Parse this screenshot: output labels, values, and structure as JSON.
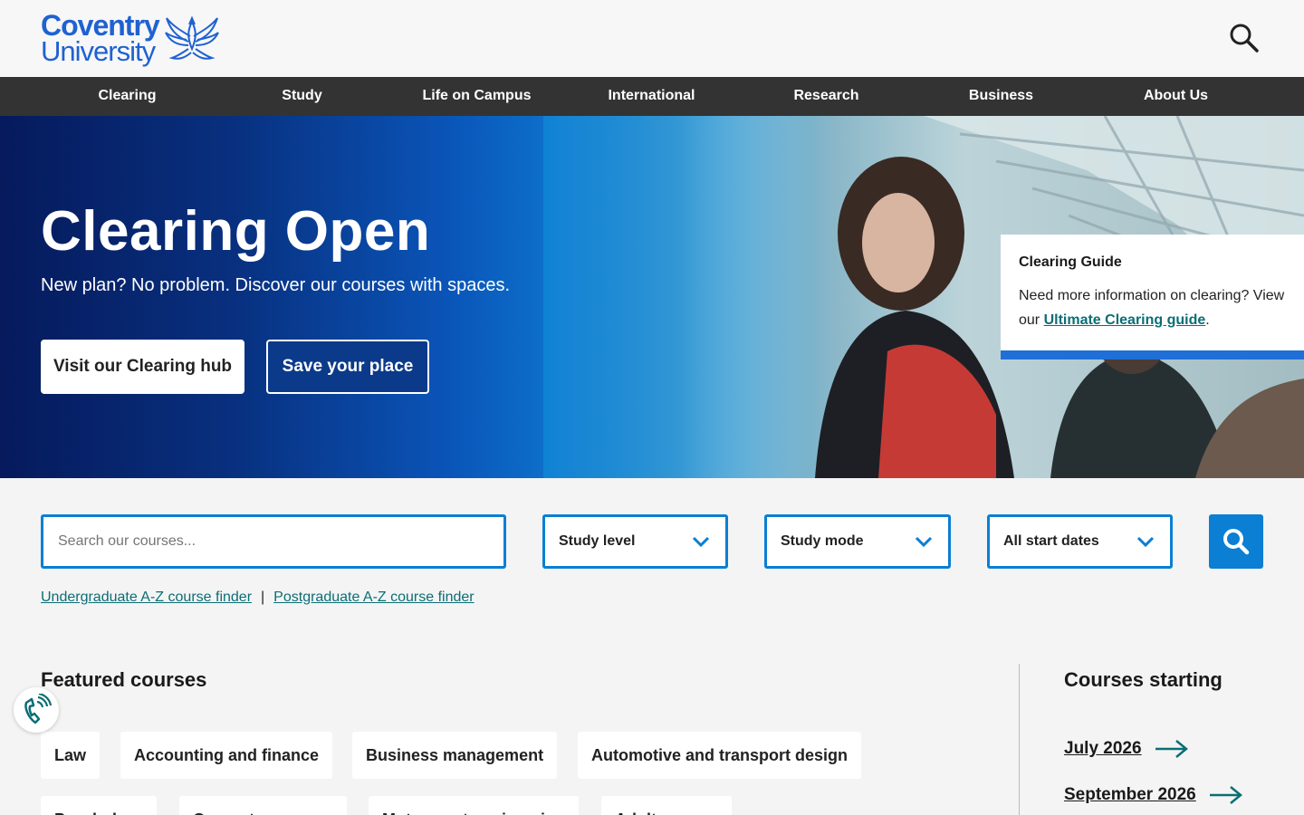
{
  "header": {
    "logo_line1": "Coventry",
    "logo_line2": "University",
    "brand_color": "#1f62d1"
  },
  "nav": {
    "items": [
      "Clearing",
      "Study",
      "Life on Campus",
      "International",
      "Research",
      "Business",
      "About Us"
    ]
  },
  "hero": {
    "title": "Clearing Open",
    "subtitle": "New plan? No problem. Discover our courses with spaces.",
    "primary_button": "Visit our Clearing hub",
    "secondary_button": "Save your place"
  },
  "guide": {
    "title": "Clearing Guide",
    "text_before": "Need more information on clearing? View our ",
    "link": "Ultimate Clearing guide",
    "text_after": "."
  },
  "search": {
    "placeholder": "Search our courses...",
    "study_level": "Study level",
    "study_mode": "Study mode",
    "start_dates": "All start dates",
    "accent": "#0a7fd3"
  },
  "az": {
    "ug": "Undergraduate A-Z course finder",
    "separator": "|",
    "pg": "Postgraduate A-Z course finder"
  },
  "featured": {
    "title": "Featured courses",
    "row1": [
      "Law",
      "Accounting and finance",
      "Business management",
      "Automotive and transport design"
    ],
    "row2": [
      "Psychology",
      "Computer science",
      "Motorsport engineering",
      "Adult nursing"
    ]
  },
  "starting": {
    "title": "Courses starting",
    "dates": [
      "July 2026",
      "September 2026"
    ]
  }
}
